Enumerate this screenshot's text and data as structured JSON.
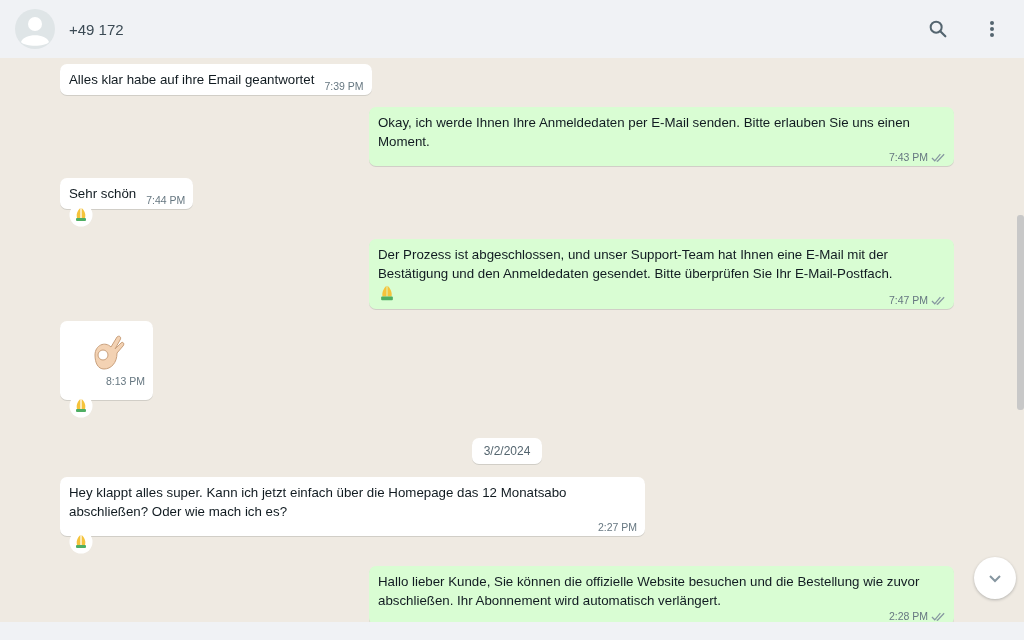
{
  "header": {
    "contact": "+49 172"
  },
  "messages": [
    {
      "kind": "text",
      "outgoing": false,
      "text": "Alles klar habe auf ihre Email geantwortet",
      "time": "7:39 PM",
      "reacted": false
    },
    {
      "kind": "text",
      "outgoing": true,
      "text": "Okay, ich werde Ihnen Ihre Anmeldedaten per E-Mail senden. Bitte erlauben Sie uns einen Moment.",
      "time": "7:43 PM",
      "read": false,
      "emoji_line": false
    },
    {
      "kind": "text",
      "outgoing": false,
      "text": "Sehr schön",
      "time": "7:44 PM",
      "reacted": true
    },
    {
      "kind": "text",
      "outgoing": true,
      "text": "Der Prozess ist abgeschlossen, und unser Support-Team hat Ihnen eine E-Mail mit der Bestätigung und den Anmeldedaten gesendet. Bitte überprüfen Sie Ihr E-Mail-Postfach.",
      "time": "7:47 PM",
      "read": false,
      "emoji_line": true
    },
    {
      "kind": "emoji",
      "outgoing": false,
      "time": "8:13 PM",
      "reacted": true
    },
    {
      "kind": "date",
      "text": "3/2/2024"
    },
    {
      "kind": "text",
      "outgoing": false,
      "text": "Hey klappt alles super. Kann ich jetzt einfach über die Homepage das 12 Monatsabo abschließen? Oder wie mach ich es?",
      "time": "2:27 PM",
      "reacted": true
    },
    {
      "kind": "text",
      "outgoing": true,
      "text": "Hallo lieber Kunde, Sie können die offizielle Website besuchen und die Bestellung wie zuvor abschließen. Ihr Abonnement wird automatisch verlängert.",
      "time": "2:28 PM",
      "read": false,
      "emoji_line": false
    }
  ]
}
